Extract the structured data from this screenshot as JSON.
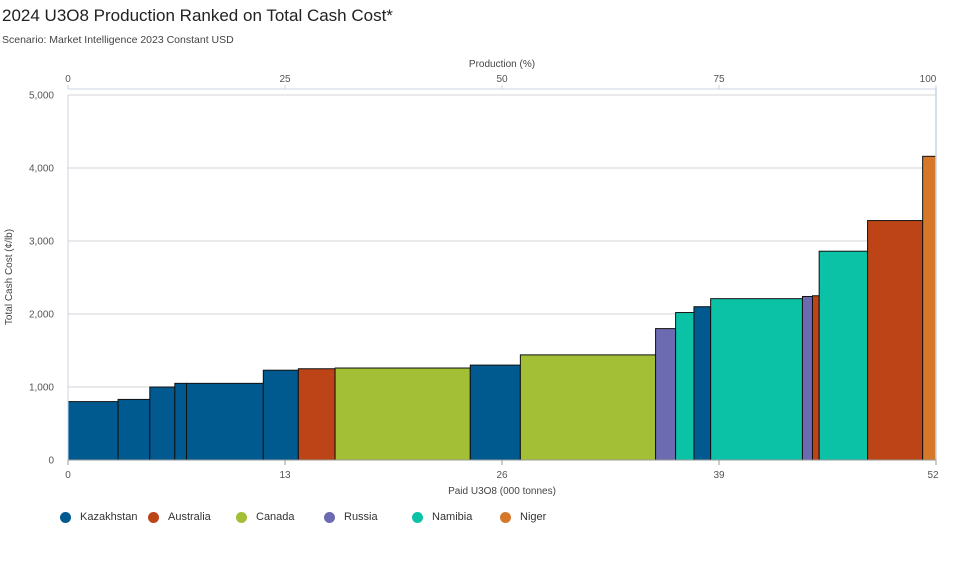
{
  "chart_data": {
    "type": "bar",
    "title": "2024 U3O8 Production Ranked on Total Cash Cost*",
    "subtitle": "Scenario: Market Intelligence 2023 Constant USD",
    "xlabel": "Paid U3O8 (000 tonnes)",
    "x2label": "Production (%)",
    "ylabel": "Total Cash Cost (¢/lb)",
    "xlim": [
      0,
      52
    ],
    "x2lim": [
      0,
      100
    ],
    "ylim": [
      0,
      5000
    ],
    "xticks": [
      0,
      13,
      26,
      39,
      52
    ],
    "x2ticks": [
      0,
      25,
      50,
      75,
      100
    ],
    "yticks": [
      0,
      1000,
      2000,
      3000,
      4000,
      5000
    ],
    "ytick_labels": [
      "0",
      "1,000",
      "2,000",
      "3,000",
      "4,000",
      "5,000"
    ],
    "grid": true,
    "legend_position": "bottom-left",
    "colors": {
      "Kazakhstan": "#005a8f",
      "Australia": "#bc4417",
      "Canada": "#a3bf35",
      "Russia": "#6c6bb2",
      "Namibia": "#0bc2a7",
      "Niger": "#d5782a"
    },
    "legend": [
      "Kazakhstan",
      "Australia",
      "Canada",
      "Russia",
      "Namibia",
      "Niger"
    ],
    "bars": [
      {
        "country": "Kazakhstan",
        "x0": 0.0,
        "x1": 3.0,
        "value": 800
      },
      {
        "country": "Kazakhstan",
        "x0": 3.0,
        "x1": 4.9,
        "value": 830
      },
      {
        "country": "Kazakhstan",
        "x0": 4.9,
        "x1": 6.4,
        "value": 1000
      },
      {
        "country": "Kazakhstan",
        "x0": 6.4,
        "x1": 7.1,
        "value": 1050
      },
      {
        "country": "Kazakhstan",
        "x0": 7.1,
        "x1": 11.7,
        "value": 1050
      },
      {
        "country": "Kazakhstan",
        "x0": 11.7,
        "x1": 13.8,
        "value": 1230
      },
      {
        "country": "Australia",
        "x0": 13.8,
        "x1": 16.0,
        "value": 1250
      },
      {
        "country": "Canada",
        "x0": 16.0,
        "x1": 24.1,
        "value": 1260
      },
      {
        "country": "Kazakhstan",
        "x0": 24.1,
        "x1": 27.1,
        "value": 1300
      },
      {
        "country": "Canada",
        "x0": 27.1,
        "x1": 35.2,
        "value": 1440
      },
      {
        "country": "Russia",
        "x0": 35.2,
        "x1": 36.4,
        "value": 1800
      },
      {
        "country": "Namibia",
        "x0": 36.4,
        "x1": 37.5,
        "value": 2020
      },
      {
        "country": "Kazakhstan",
        "x0": 37.5,
        "x1": 38.5,
        "value": 2100
      },
      {
        "country": "Namibia",
        "x0": 38.5,
        "x1": 44.0,
        "value": 2210
      },
      {
        "country": "Russia",
        "x0": 44.0,
        "x1": 44.6,
        "value": 2240
      },
      {
        "country": "Australia",
        "x0": 44.6,
        "x1": 45.0,
        "value": 2250
      },
      {
        "country": "Namibia",
        "x0": 45.0,
        "x1": 47.9,
        "value": 2860
      },
      {
        "country": "Australia",
        "x0": 47.9,
        "x1": 51.2,
        "value": 3280
      },
      {
        "country": "Niger",
        "x0": 51.2,
        "x1": 52.0,
        "value": 4160
      }
    ]
  }
}
